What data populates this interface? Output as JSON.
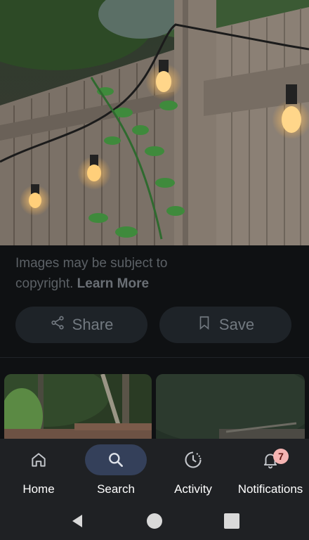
{
  "caption": {
    "text": "Images may be subject to copyright.",
    "link": "Learn More"
  },
  "actions": {
    "share": "Share",
    "save": "Save"
  },
  "nav": {
    "items": [
      {
        "label": "Home",
        "icon": "home-icon"
      },
      {
        "label": "Search",
        "icon": "search-icon",
        "active": true
      },
      {
        "label": "Activity",
        "icon": "activity-icon"
      },
      {
        "label": "Notifications",
        "icon": "bell-icon",
        "badge": "7"
      }
    ]
  },
  "colors": {
    "background": "#0f1113",
    "navbar": "#1f2124",
    "active_pill": "#34405a",
    "badge": "#f5b4b2"
  }
}
